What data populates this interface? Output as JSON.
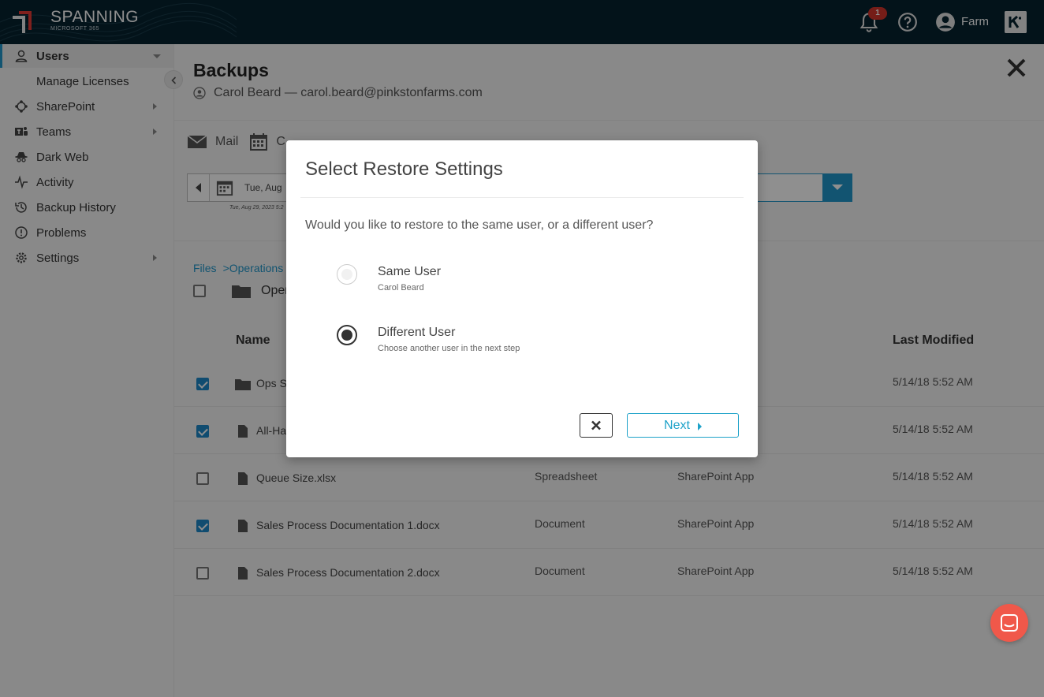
{
  "app": {
    "brand_title": "SPANNING",
    "brand_subtitle": "MICROSOFT 365",
    "notification_count": "1",
    "account_name": "Farm"
  },
  "sidebar": {
    "items": [
      {
        "label": "Users",
        "icon": "user-icon",
        "active": true
      },
      {
        "label": "Manage Licenses"
      },
      {
        "label": "SharePoint",
        "icon": "sharepoint-icon"
      },
      {
        "label": "Teams",
        "icon": "teams-icon"
      },
      {
        "label": "Dark Web",
        "icon": "spy-icon"
      },
      {
        "label": "Activity",
        "icon": "pulse-icon"
      },
      {
        "label": "Backup History",
        "icon": "history-icon"
      },
      {
        "label": "Problems",
        "icon": "alert-circle-icon"
      },
      {
        "label": "Settings",
        "icon": "gear-icon"
      }
    ]
  },
  "main": {
    "title": "Backups",
    "user_line": "Carol Beard — carol.beard@pinkstonfarms.com",
    "tabs": [
      "Mail",
      "C"
    ],
    "date_text": "Tue, Aug",
    "date_small": "Tue, Aug 29, 2023 5:2",
    "breadcrumbs": [
      "Files",
      ">Operations"
    ],
    "current_folder": "Oper",
    "columns": {
      "name": "Name",
      "last_modified": "Last Modified"
    },
    "rows": [
      {
        "name": "Ops S",
        "type": "",
        "source": "",
        "modified": "5/14/18 5:52 AM",
        "checked": true,
        "kind": "folder"
      },
      {
        "name": "All-Ha",
        "type": "",
        "source": "",
        "modified": "5/14/18 5:52 AM",
        "checked": true,
        "kind": "file"
      },
      {
        "name": "Queue Size.xlsx",
        "type": "Spreadsheet",
        "source": "SharePoint App",
        "modified": "5/14/18 5:52 AM",
        "checked": false,
        "kind": "file"
      },
      {
        "name": "Sales Process Documentation 1.docx",
        "type": "Document",
        "source": "SharePoint App",
        "modified": "5/14/18 5:52 AM",
        "checked": true,
        "kind": "file"
      },
      {
        "name": "Sales Process Documentation 2.docx",
        "type": "Document",
        "source": "SharePoint App",
        "modified": "5/14/18 5:52 AM",
        "checked": false,
        "kind": "file"
      }
    ]
  },
  "dialog": {
    "title": "Select Restore Settings",
    "question": "Would you like to restore to the same user, or a different user?",
    "options": [
      {
        "title": "Same User",
        "subtitle": "Carol Beard",
        "selected": false
      },
      {
        "title": "Different User",
        "subtitle": "Choose another user in the next step",
        "selected": true
      }
    ],
    "next_label": "Next"
  },
  "colors": {
    "topbar": "#06222f",
    "accent": "#2196c9",
    "next_button": "#1ea2c9",
    "chat_button": "#f0584a",
    "badge": "#d0342c"
  }
}
